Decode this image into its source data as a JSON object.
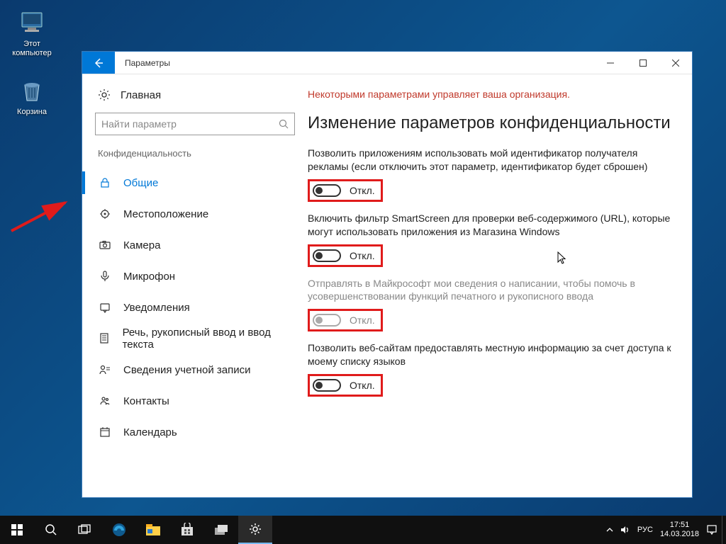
{
  "desktop": {
    "this_pc": "Этот компьютер",
    "recycle_bin": "Корзина"
  },
  "window": {
    "title": "Параметры",
    "home": "Главная",
    "search_placeholder": "Найти параметр",
    "nav_group": "Конфиденциальность",
    "nav_items": [
      {
        "id": "general",
        "label": "Общие",
        "selected": true
      },
      {
        "id": "location",
        "label": "Местоположение",
        "selected": false
      },
      {
        "id": "camera",
        "label": "Камера",
        "selected": false
      },
      {
        "id": "microphone",
        "label": "Микрофон",
        "selected": false
      },
      {
        "id": "notifications",
        "label": "Уведомления",
        "selected": false
      },
      {
        "id": "speech",
        "label": "Речь, рукописный ввод и ввод текста",
        "selected": false
      },
      {
        "id": "account",
        "label": "Сведения учетной записи",
        "selected": false
      },
      {
        "id": "contacts",
        "label": "Контакты",
        "selected": false
      },
      {
        "id": "calendar",
        "label": "Календарь",
        "selected": false
      }
    ],
    "management_notice": "Некоторыми параметрами управляет ваша организация.",
    "page_heading": "Изменение параметров конфиденциальности",
    "settings": [
      {
        "desc": "Позволить приложениям использовать мой идентификатор получателя рекламы (если отключить этот параметр, идентификатор будет сброшен)",
        "state_label": "Откл.",
        "highlighted": true,
        "disabled": false
      },
      {
        "desc": "Включить фильтр SmartScreen для проверки веб-содержимого (URL), которые могут использовать приложения из Магазина Windows",
        "state_label": "Откл.",
        "highlighted": true,
        "disabled": false
      },
      {
        "desc": "Отправлять в Майкрософт мои сведения о написании, чтобы помочь в усовершенствовании функций печатного и рукописного ввода",
        "state_label": "Откл.",
        "highlighted": true,
        "disabled": true
      },
      {
        "desc": "Позволить веб-сайтам предоставлять местную информацию за счет доступа к моему списку языков",
        "state_label": "Откл.",
        "highlighted": true,
        "disabled": false
      }
    ]
  },
  "taskbar": {
    "lang": "РУС",
    "time": "17:51",
    "date": "14.03.2018"
  }
}
